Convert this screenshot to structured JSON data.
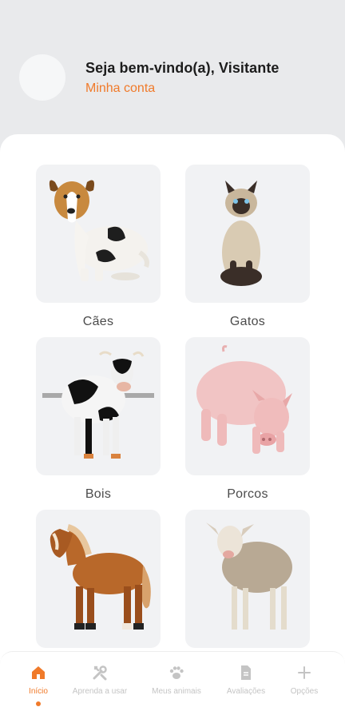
{
  "header": {
    "welcome_text": "Seja bem-vindo(a), Visitante",
    "account_link": "Minha conta"
  },
  "categories": [
    {
      "label": "Cães",
      "image": "dog"
    },
    {
      "label": "Gatos",
      "image": "cat"
    },
    {
      "label": "Bois",
      "image": "cow"
    },
    {
      "label": "Porcos",
      "image": "pig"
    },
    {
      "label": "",
      "image": "horse"
    },
    {
      "label": "",
      "image": "sheep"
    }
  ],
  "navbar": {
    "items": [
      {
        "label": "Início",
        "icon": "home-icon",
        "active": true
      },
      {
        "label": "Aprenda a usar",
        "icon": "tools-icon",
        "active": false
      },
      {
        "label": "Meus animais",
        "icon": "paw-icon",
        "active": false
      },
      {
        "label": "Avaliações",
        "icon": "document-icon",
        "active": false
      },
      {
        "label": "Opções",
        "icon": "plus-icon",
        "active": false
      }
    ]
  },
  "colors": {
    "accent": "#f07a2a",
    "background": "#e9eaec",
    "card": "#f1f2f4",
    "inactive": "#c4c4c4"
  }
}
